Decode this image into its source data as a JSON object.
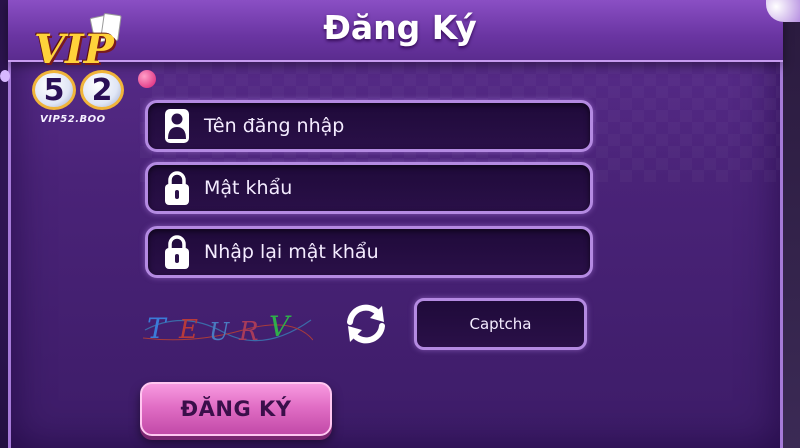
{
  "dialog": {
    "title": "Đăng Ký"
  },
  "logo": {
    "brand": "VIP",
    "number_left": "5",
    "number_right": "2",
    "domain": "VIP52.BOO"
  },
  "form": {
    "username_placeholder": "Tên đăng nhập",
    "password_placeholder": "Mật khẩu",
    "confirm_password_placeholder": "Nhập lại mật khẩu",
    "captcha_image_text": "TEURV",
    "captcha_placeholder": "Captcha",
    "submit_label": "ĐĂNG KÝ"
  },
  "icons": {
    "username": "user-icon",
    "password": "lock-icon",
    "confirm_password": "lock-icon",
    "refresh_captcha": "refresh-icon"
  },
  "colors": {
    "panel": "#4a2378",
    "header": "#6a35a2",
    "field_border": "#b48ae2",
    "submit": "#e16ec5"
  }
}
